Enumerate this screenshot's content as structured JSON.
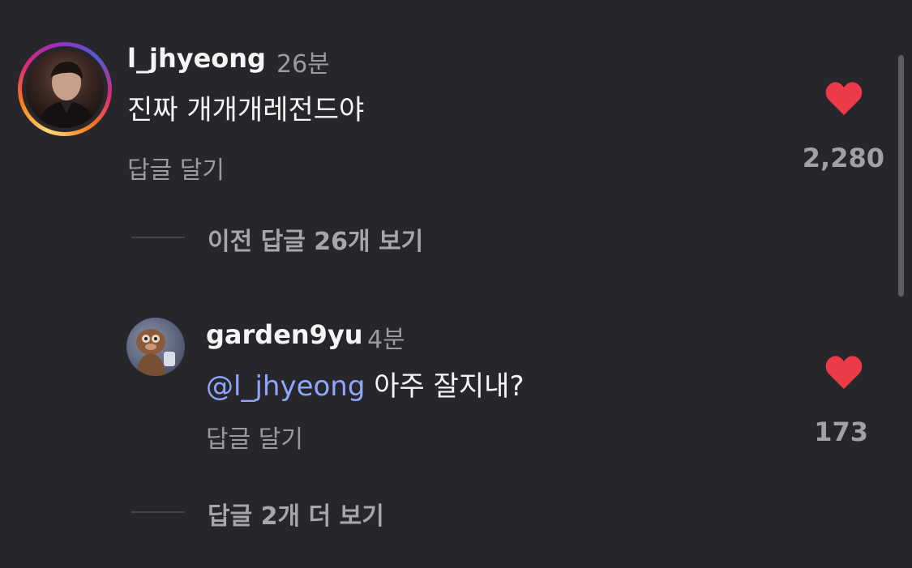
{
  "colors": {
    "background": "#26262b",
    "heart": "#ed3a47",
    "mention": "#8fa6ff",
    "muted": "#9a9aa0"
  },
  "comments": [
    {
      "username": "l_jhyeong",
      "time": "26분",
      "text": "진짜 개개개레전드야",
      "reply_label": "답글 달기",
      "like_count": "2,280",
      "liked": true,
      "has_story_ring": true
    },
    {
      "username": "garden9yu",
      "time": "4분",
      "mention": "@l_jhyeong",
      "text": "아주 잘지내?",
      "reply_label": "답글 달기",
      "like_count": "173",
      "liked": true,
      "has_story_ring": false
    }
  ],
  "view_previous_replies": "이전 답글 26개 보기",
  "view_more_replies": "답글 2개 더 보기",
  "icons": [
    "heart-icon",
    "avatar"
  ]
}
